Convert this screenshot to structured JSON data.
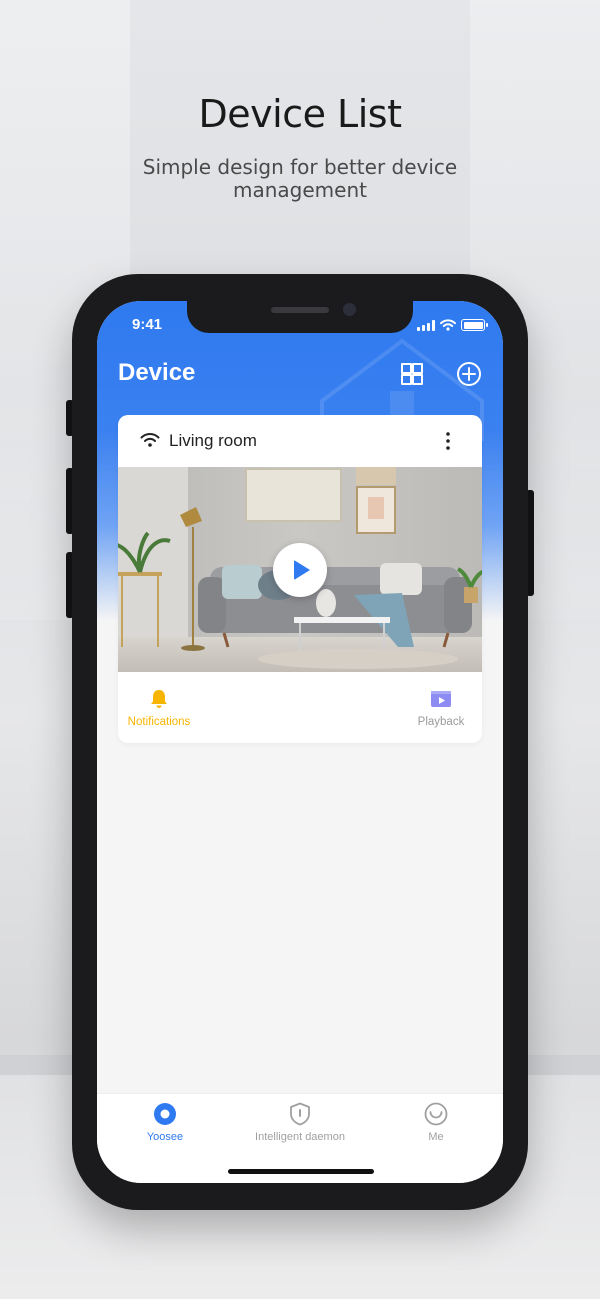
{
  "hero": {
    "title": "Device List",
    "subtitle": "Simple design for better device management"
  },
  "status_bar": {
    "time": "9:41",
    "icons": [
      "signal-icon",
      "wifi-icon",
      "battery-icon"
    ]
  },
  "header": {
    "title": "Device",
    "actions": [
      "grid-view-icon",
      "add-device-icon"
    ]
  },
  "device_card": {
    "name": "Living room",
    "connection_icon": "wifi-icon",
    "menu_icon": "more-vertical-icon",
    "preview_icon": "play-icon",
    "actions": [
      {
        "label": "Notifications",
        "icon": "bell-icon",
        "color": "#f7b500"
      },
      {
        "label": "Playback",
        "icon": "playback-icon",
        "color": "#9a9a9a"
      }
    ]
  },
  "tabbar": {
    "items": [
      {
        "label": "Yoosee",
        "icon": "camera-icon",
        "active": true
      },
      {
        "label": "Intelligent daemon",
        "icon": "shield-icon",
        "active": false
      },
      {
        "label": "Me",
        "icon": "profile-icon",
        "active": false
      }
    ]
  },
  "colors": {
    "accent": "#2f7af0",
    "notification": "#f7b500",
    "inactive": "#a0a0a0"
  }
}
